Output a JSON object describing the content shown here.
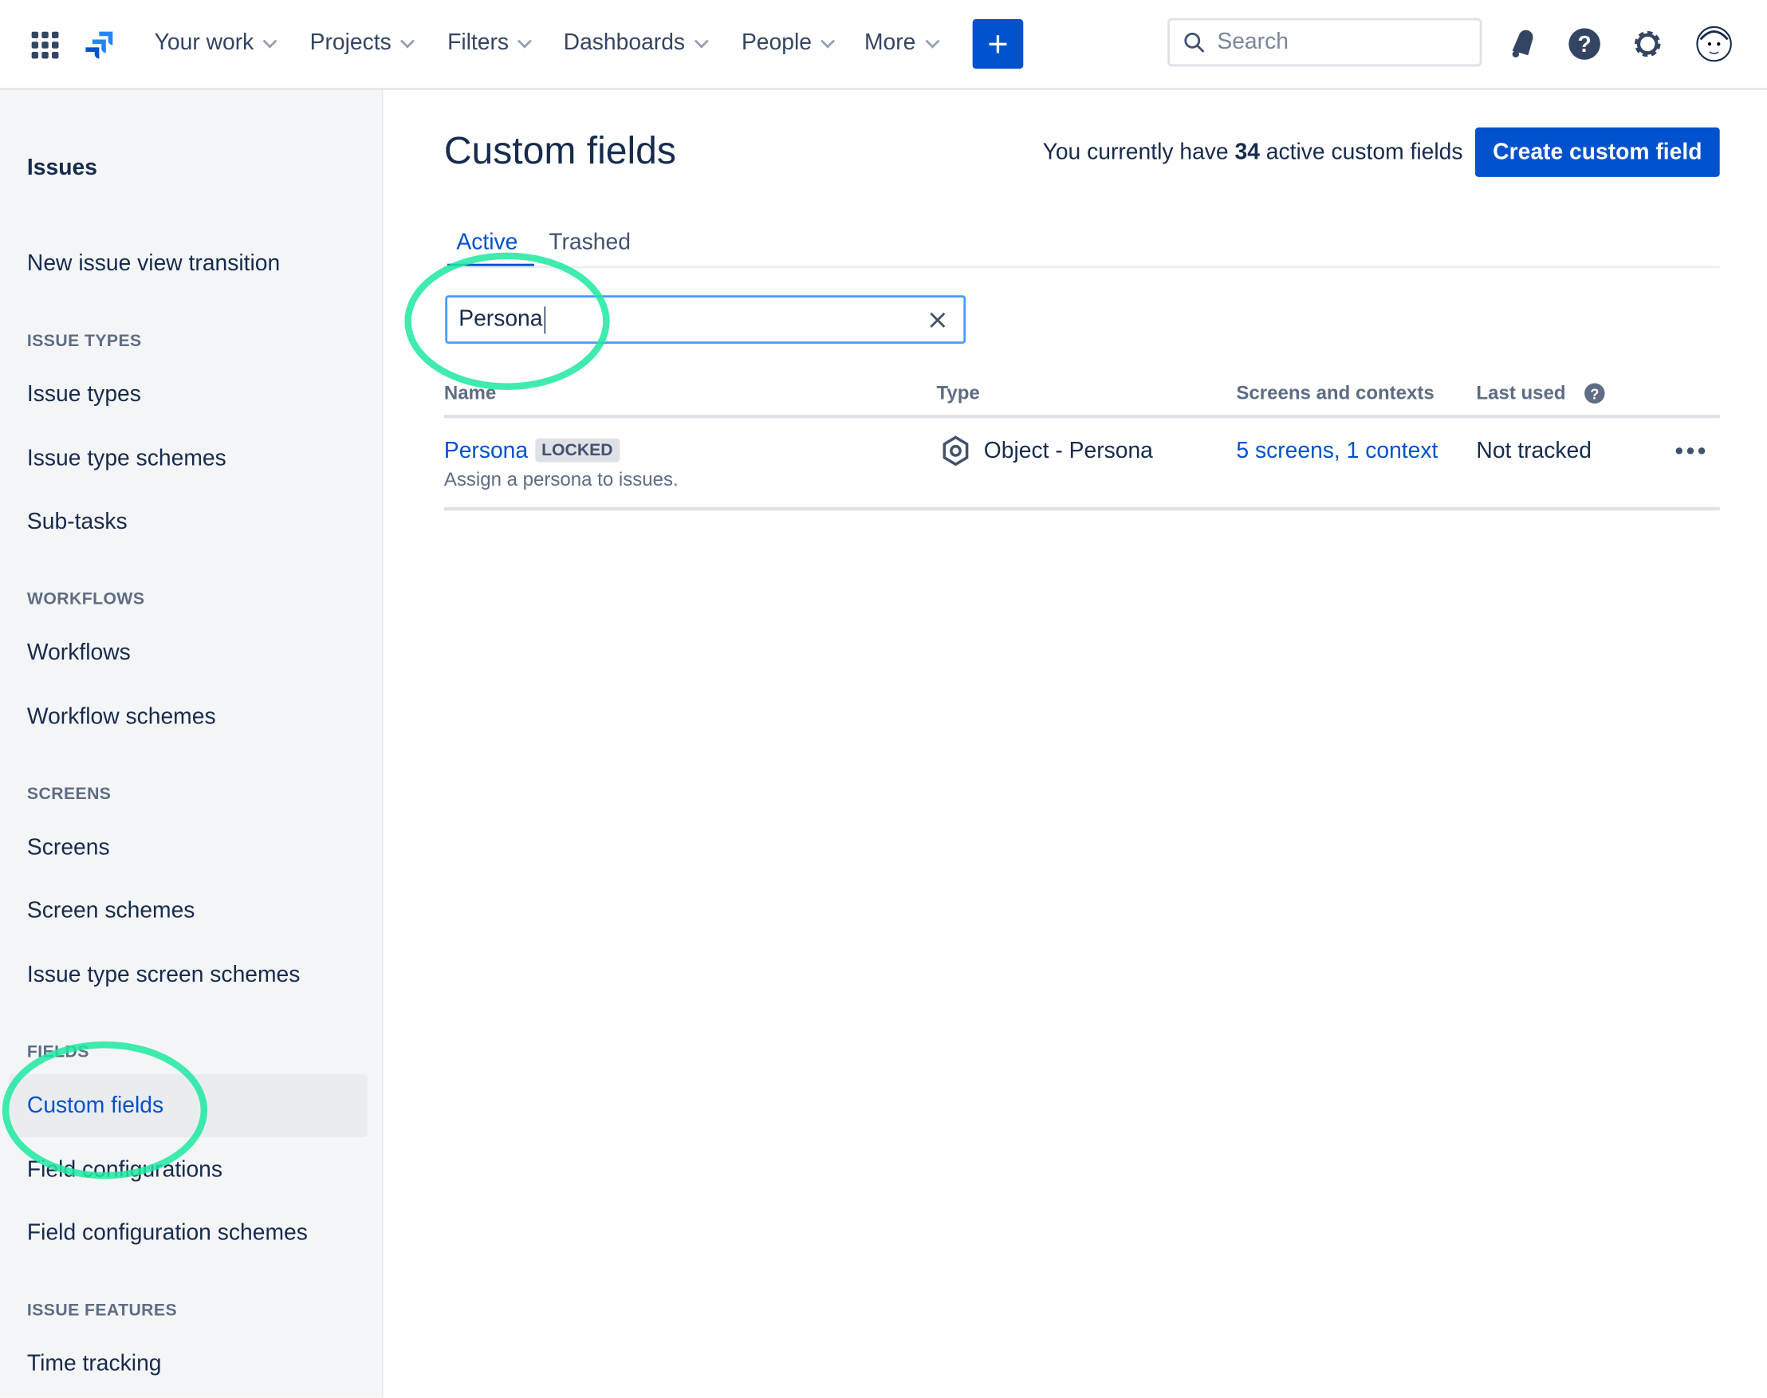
{
  "topnav": {
    "items": [
      "Your work",
      "Projects",
      "Filters",
      "Dashboards",
      "People",
      "More"
    ],
    "create_label": "+",
    "search_placeholder": "Search"
  },
  "sidebar": {
    "title": "Issues",
    "link_transition": "New issue view transition",
    "sections": [
      {
        "heading": "ISSUE TYPES",
        "items": [
          "Issue types",
          "Issue type schemes",
          "Sub-tasks"
        ]
      },
      {
        "heading": "WORKFLOWS",
        "items": [
          "Workflows",
          "Workflow schemes"
        ]
      },
      {
        "heading": "SCREENS",
        "items": [
          "Screens",
          "Screen schemes",
          "Issue type screen schemes"
        ]
      },
      {
        "heading": "FIELDS",
        "items": [
          "Custom fields",
          "Field configurations",
          "Field configuration schemes"
        ]
      },
      {
        "heading": "ISSUE FEATURES",
        "items": [
          "Time tracking"
        ]
      }
    ],
    "active": "Custom fields"
  },
  "main": {
    "title": "Custom fields",
    "summary_prefix": "You currently have ",
    "summary_count": "34",
    "summary_suffix": " active custom fields",
    "create_button": "Create custom field",
    "tabs": [
      "Active",
      "Trashed"
    ],
    "search_value": "Persona",
    "columns": [
      "Name",
      "Type",
      "Screens and contexts",
      "Last used"
    ],
    "rows": [
      {
        "name": "Persona",
        "badge": "LOCKED",
        "description": "Assign a persona to issues.",
        "type": "Object - Persona",
        "screens": "5 screens, 1 context",
        "last_used": "Not tracked"
      }
    ]
  },
  "colors": {
    "accent": "#0052cc",
    "annotation": "#1de9a0"
  }
}
